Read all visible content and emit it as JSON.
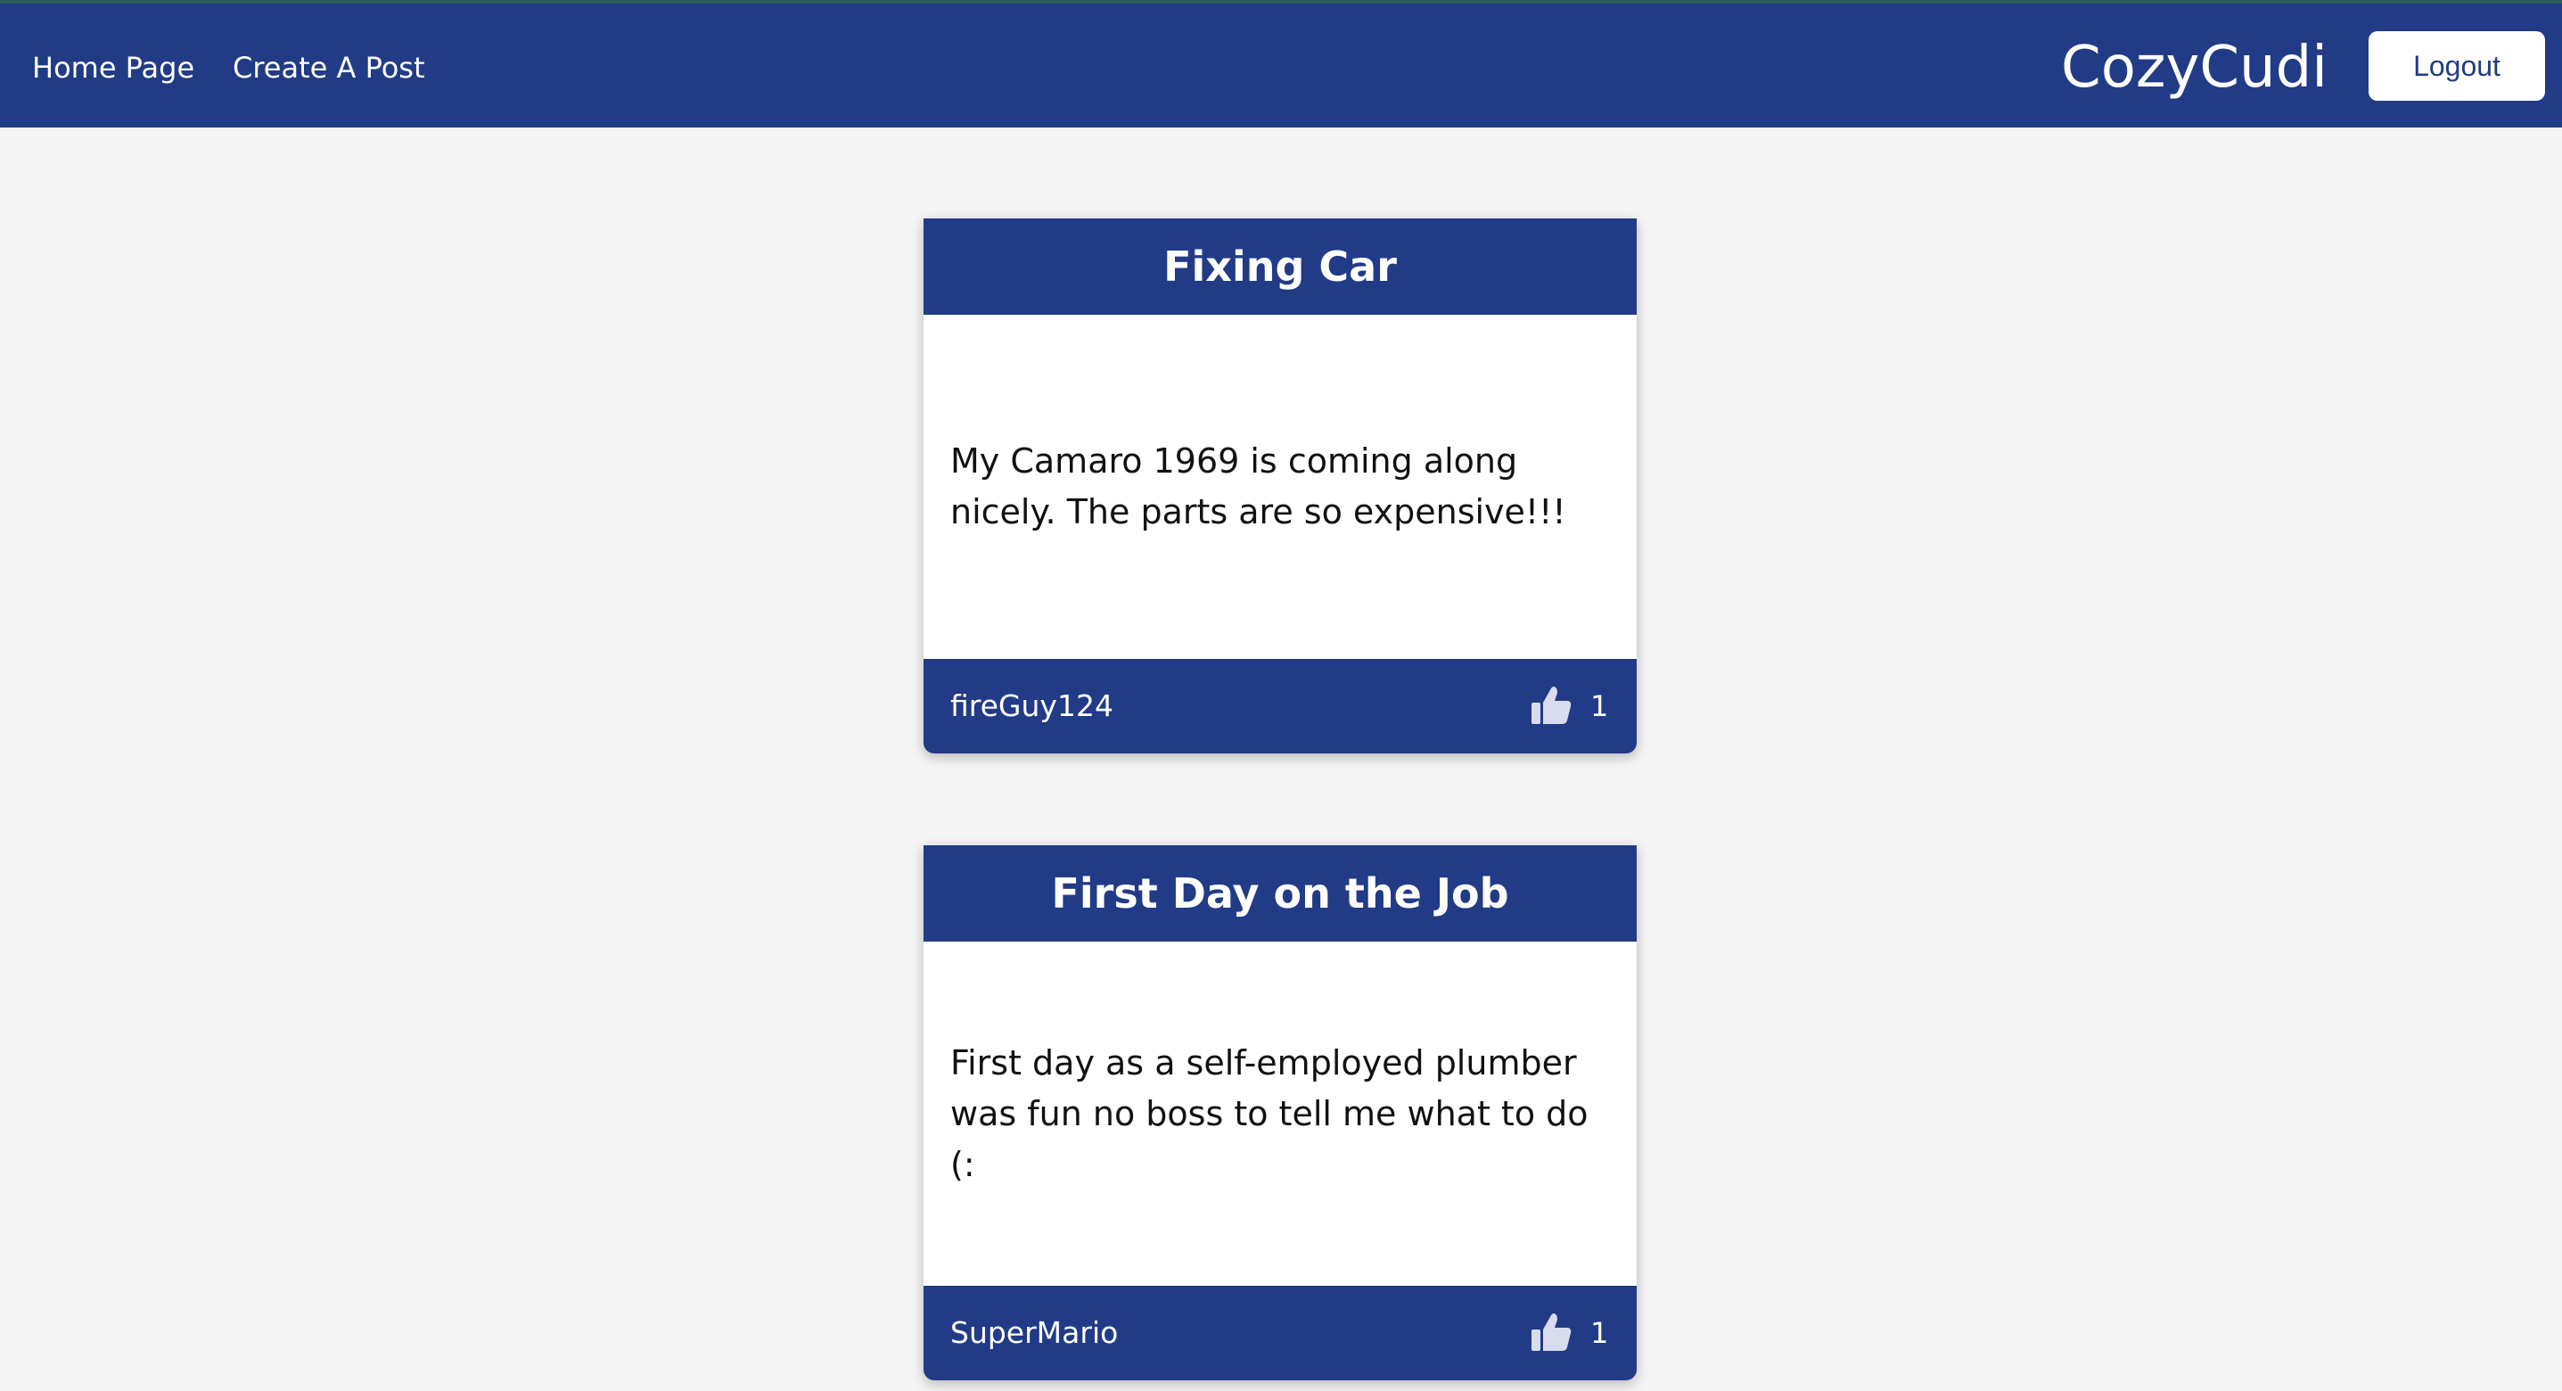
{
  "nav": {
    "home_label": "Home Page",
    "create_label": "Create A Post",
    "brand": "CozyCudi",
    "logout_label": "Logout"
  },
  "posts": [
    {
      "title": "Fixing Car",
      "body": "My Camaro 1969 is coming along nicely. The parts are so expensive!!!",
      "author": "fireGuy124",
      "likes": "1",
      "like_icon": "thumbs-up-icon"
    },
    {
      "title": "First Day on the Job",
      "body": "First day as a self-employed plumber was fun no boss to tell me what to do (:",
      "author": "SuperMario",
      "likes": "1",
      "like_icon": "thumbs-up-icon"
    }
  ],
  "colors": {
    "primary": "#223b87",
    "background": "#f4f4f4",
    "card": "#ffffff",
    "text": "#111111"
  }
}
